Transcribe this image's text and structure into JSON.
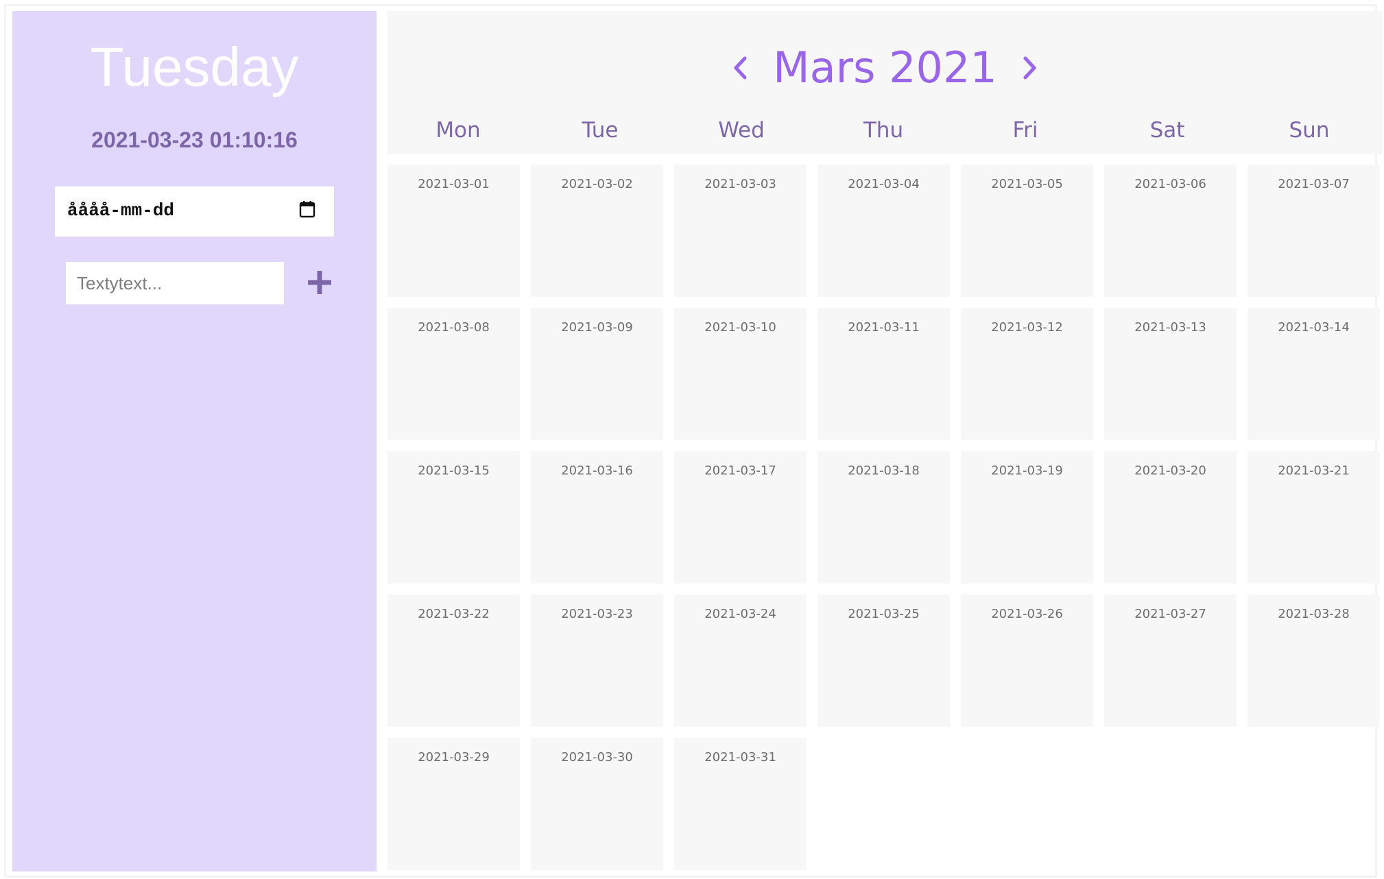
{
  "sidebar": {
    "day_name": "Tuesday",
    "datetime": "2021-03-23 01:10:16",
    "date_input_text": "åååå-mm-dd",
    "text_placeholder": "Textytext...",
    "add_icon": "plus-icon"
  },
  "calendar": {
    "month_title": "Mars 2021",
    "prev_icon": "chevron-left-icon",
    "next_icon": "chevron-right-icon",
    "weekdays": [
      "Mon",
      "Tue",
      "Wed",
      "Thu",
      "Fri",
      "Sat",
      "Sun"
    ],
    "days": [
      "2021-03-01",
      "2021-03-02",
      "2021-03-03",
      "2021-03-04",
      "2021-03-05",
      "2021-03-06",
      "2021-03-07",
      "2021-03-08",
      "2021-03-09",
      "2021-03-10",
      "2021-03-11",
      "2021-03-12",
      "2021-03-13",
      "2021-03-14",
      "2021-03-15",
      "2021-03-16",
      "2021-03-17",
      "2021-03-18",
      "2021-03-19",
      "2021-03-20",
      "2021-03-21",
      "2021-03-22",
      "2021-03-23",
      "2021-03-24",
      "2021-03-25",
      "2021-03-26",
      "2021-03-27",
      "2021-03-28",
      "2021-03-29",
      "2021-03-30",
      "2021-03-31"
    ]
  },
  "colors": {
    "sidebar_bg": "#e1d7fb",
    "accent": "#9966e8",
    "muted_purple": "#7c66a8",
    "cell_bg": "#f7f7f7"
  }
}
